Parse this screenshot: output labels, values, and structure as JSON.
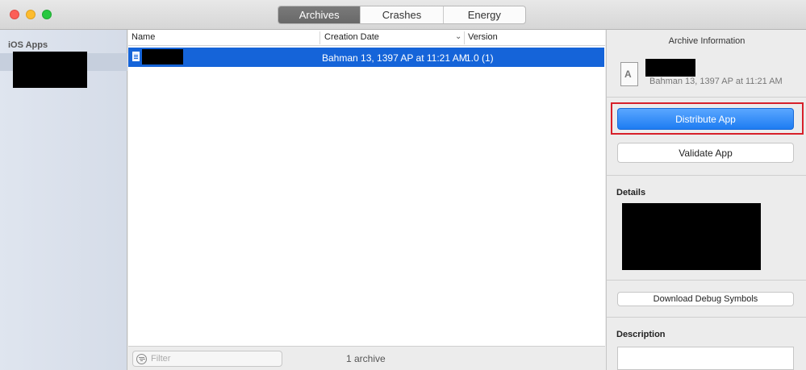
{
  "toolbar": {
    "tabs": [
      {
        "label": "Archives",
        "active": true
      },
      {
        "label": "Crashes",
        "active": false
      },
      {
        "label": "Energy",
        "active": false
      }
    ]
  },
  "sidebar": {
    "header": "iOS Apps"
  },
  "list": {
    "columns": [
      "Name",
      "Creation Date",
      "Version"
    ],
    "rows": [
      {
        "name": "",
        "date": "Bahman 13, 1397 AP at 11:21 AM",
        "version": "1.0 (1)",
        "selected": true
      }
    ]
  },
  "footer": {
    "filter_placeholder": "Filter",
    "count": "1 archive"
  },
  "inspector": {
    "title": "Archive Information",
    "date": "Bahman 13, 1397 AP at 11:21 AM",
    "distribute_label": "Distribute App",
    "validate_label": "Validate App",
    "details_label": "Details",
    "debug_symbols_label": "Download Debug Symbols",
    "description_label": "Description"
  },
  "colors": {
    "selection": "#1564d9",
    "primary_button": "#1d7cf2",
    "highlight": "#d7202a"
  }
}
